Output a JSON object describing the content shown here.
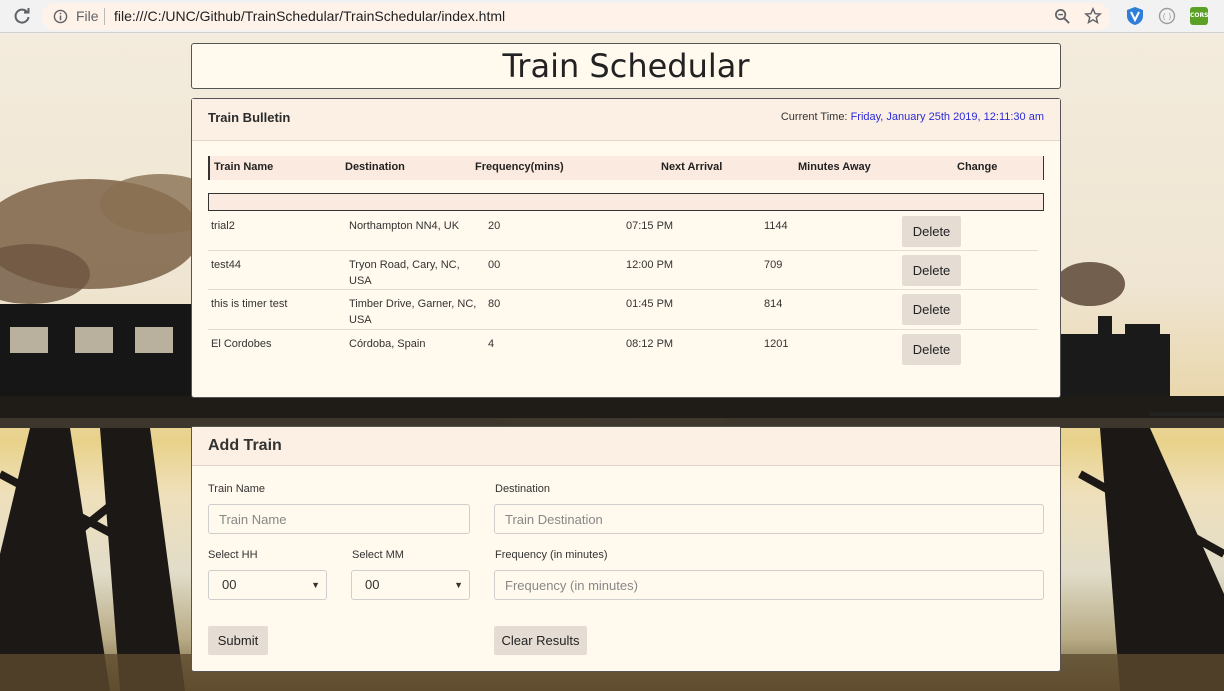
{
  "browser": {
    "scheme": "File",
    "url": "file:///C:/UNC/Github/TrainSchedular/TrainSchedular/index.html",
    "ext_cors_label": "CORS"
  },
  "page": {
    "title": "Train Schedular"
  },
  "bulletin": {
    "title": "Train Bulletin",
    "time_label": "Current Time:",
    "time_value": "Friday, January 25th 2019, 12:11:30 am",
    "columns": [
      "Train Name",
      "Destination",
      "Frequency(mins)",
      "Next Arrival",
      "Minutes Away",
      "Change"
    ],
    "rows": [
      {
        "name": "trial2",
        "destination": "Northampton NN4, UK",
        "frequency": "20",
        "next_arrival": "07:15 PM",
        "minutes_away": "1144",
        "action": "Delete"
      },
      {
        "name": "test44",
        "destination": "Tryon Road, Cary, NC, USA",
        "frequency": "00",
        "next_arrival": "12:00 PM",
        "minutes_away": "709",
        "action": "Delete"
      },
      {
        "name": "this is timer test",
        "destination": "Timber Drive, Garner, NC, USA",
        "frequency": "80",
        "next_arrival": "01:45 PM",
        "minutes_away": "814",
        "action": "Delete"
      },
      {
        "name": "El Cordobes",
        "destination": "Córdoba, Spain",
        "frequency": "4",
        "next_arrival": "08:12 PM",
        "minutes_away": "1201",
        "action": "Delete"
      }
    ]
  },
  "form": {
    "title": "Add Train",
    "train_name_label": "Train Name",
    "train_name_placeholder": "Train Name",
    "destination_label": "Destination",
    "destination_placeholder": "Train Destination",
    "hh_label": "Select HH",
    "hh_value": "00",
    "mm_label": "Select MM",
    "mm_value": "00",
    "frequency_label": "Frequency (in minutes)",
    "frequency_placeholder": "Frequency (in minutes)",
    "submit_label": "Submit",
    "clear_label": "Clear Results"
  }
}
